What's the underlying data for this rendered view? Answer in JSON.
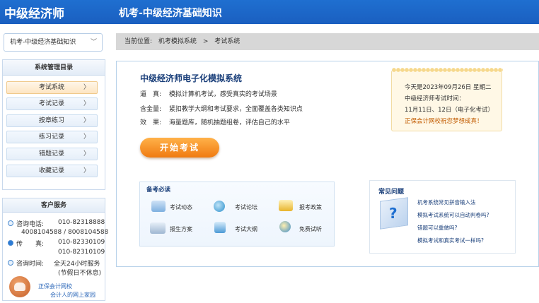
{
  "header": {
    "logo": "中级经济师",
    "title": "机考-中级经济基础知识"
  },
  "subject_select": {
    "value": "机考-中级经济基础知识",
    "chevron": "﹀"
  },
  "menu": {
    "title": "系统管理目录",
    "arrow": "〉",
    "items": [
      {
        "label": "考试系统",
        "active": true
      },
      {
        "label": "考试记录",
        "active": false
      },
      {
        "label": "按章练习",
        "active": false
      },
      {
        "label": "练习记录",
        "active": false
      },
      {
        "label": "错题记录",
        "active": false
      },
      {
        "label": "收藏记录",
        "active": false
      }
    ]
  },
  "service": {
    "title": "客户服务",
    "phone_label": "咨询电话:",
    "phone_1": "010-82318888",
    "phone_2": "4008104588 / 8008104588",
    "fax_label": "传　　真:",
    "fax_1": "010-82330109",
    "fax_2": "010-82310109",
    "hours_label": "咨询时间:",
    "hours_1": "全天24小时服务",
    "hours_2": "(节假日不休息)",
    "link_1": "正保会计网校",
    "link_2": "会计人的网上家园"
  },
  "breadcrumb": {
    "prefix": "当前位置:",
    "crumb_1": "机考模拟系统",
    "sep": ">",
    "crumb_2": "考试系统"
  },
  "system": {
    "title": "中级经济师电子化模拟系统",
    "features": [
      {
        "key": "逼　真:",
        "text": "模拟计算机考试，感受真实的考试场景"
      },
      {
        "key": "含金量:",
        "text": "紧扣教学大纲和考试要求，全面覆盖各类知识点"
      },
      {
        "key": "效　果:",
        "text": "海量题库，随机抽题组卷，评估自己的水平"
      }
    ],
    "start_button": "开始考试"
  },
  "notice": {
    "line_1": "今天是2023年09月26日 星期二",
    "line_2": "中级经济师考试时间：",
    "line_3": "11月11日、12日（电子化考试）",
    "line_4": "正保会计网校祝您梦想成真！"
  },
  "prep": {
    "title": "备考必读",
    "items": [
      {
        "label": "考试动态",
        "icon": "news-icon"
      },
      {
        "label": "考试论坛",
        "icon": "forum-icon"
      },
      {
        "label": "报考政策",
        "icon": "policy-icon"
      },
      {
        "label": "报生方案",
        "icon": "plan-icon"
      },
      {
        "label": "考试大纲",
        "icon": "syllabus-icon"
      },
      {
        "label": "免费试听",
        "icon": "audition-icon"
      }
    ]
  },
  "faq": {
    "title": "常见问题",
    "icon_glyph": "?",
    "items": [
      "机考系统常见拼音输入法",
      "模拟考试系统可以自动判卷吗?",
      "错题可以重做吗?",
      "模拟考试和真实考试一样吗?"
    ]
  },
  "colors": {
    "header": "#1a5fc0",
    "accent_orange": "#f07a10",
    "breadcrumb_bg": "#d7d7d7"
  }
}
